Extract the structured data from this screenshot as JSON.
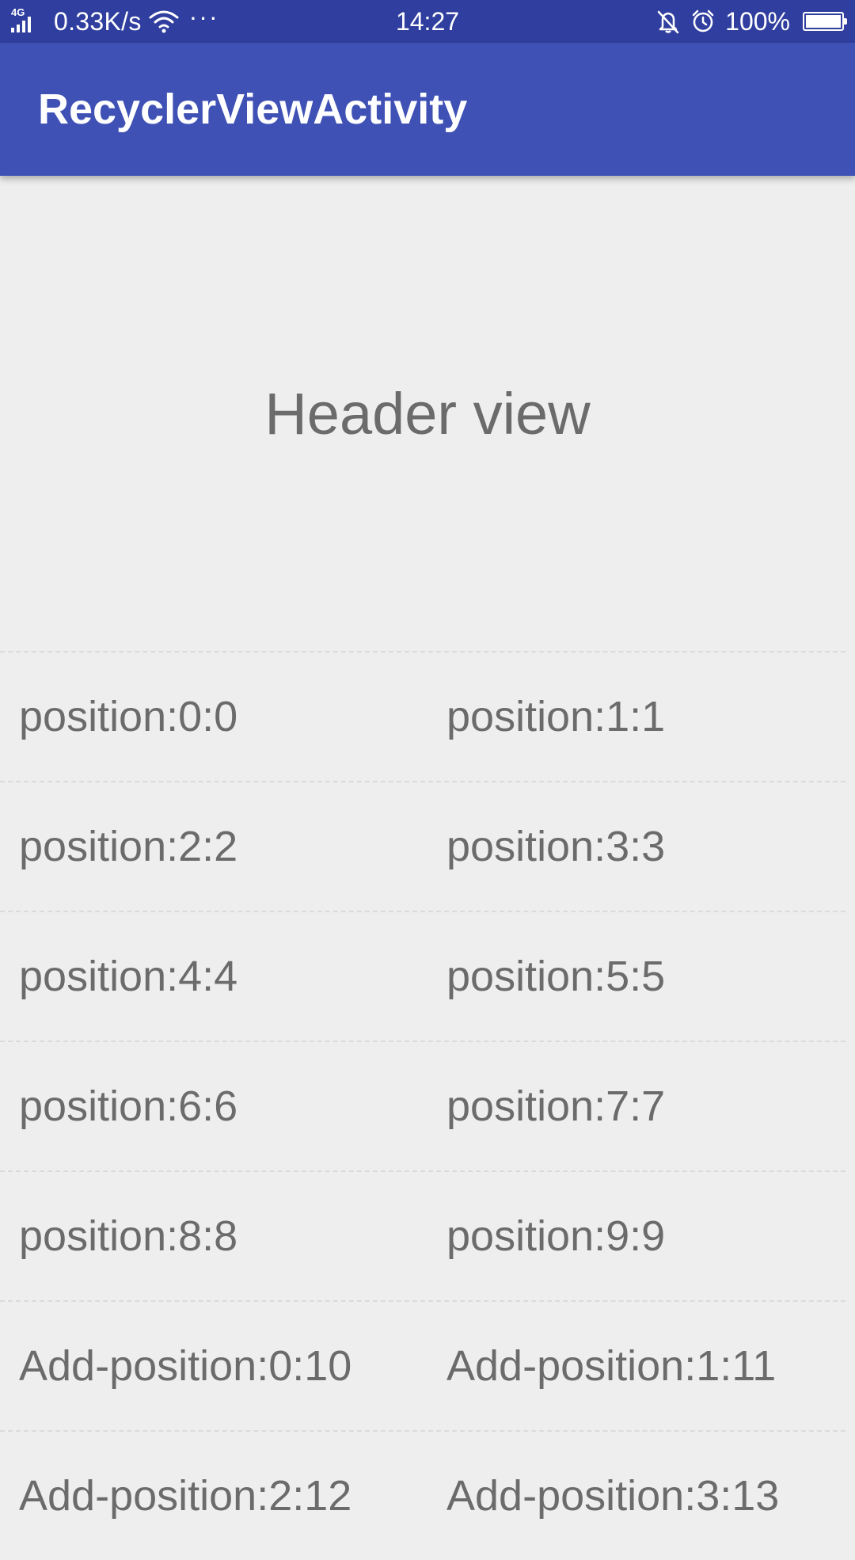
{
  "status_bar": {
    "network": "4G",
    "speed": "0.33K/s",
    "more": "···",
    "time": "14:27",
    "battery_percent": "100%",
    "battery_level": 1.0
  },
  "app_bar": {
    "title": "RecyclerViewActivity"
  },
  "list": {
    "header": "Header view",
    "rows": [
      [
        "position:0:0",
        "position:1:1"
      ],
      [
        "position:2:2",
        "position:3:3"
      ],
      [
        "position:4:4",
        "position:5:5"
      ],
      [
        "position:6:6",
        "position:7:7"
      ],
      [
        "position:8:8",
        "position:9:9"
      ],
      [
        "Add-position:0:10",
        "Add-position:1:11"
      ],
      [
        "Add-position:2:12",
        "Add-position:3:13"
      ]
    ]
  },
  "colors": {
    "status_bar": "#303f9f",
    "app_bar": "#3f51b5",
    "background": "#eeeeee",
    "item_text": "#6b6b6b"
  },
  "icons": [
    "signal-icon",
    "wifi-icon",
    "more-icon",
    "bell-off-icon",
    "alarm-icon",
    "battery-icon"
  ]
}
